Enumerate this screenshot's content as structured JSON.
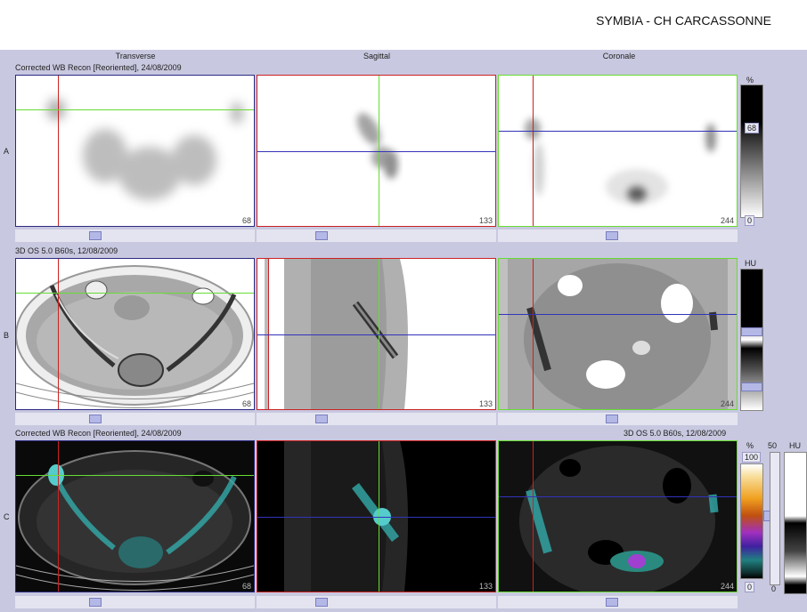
{
  "header": {
    "title": "SYMBIA - CH CARCASSONNE"
  },
  "columns": [
    "Transverse",
    "Sagittal",
    "Coronale"
  ],
  "rows": {
    "A": {
      "label": "A",
      "series": "Corrected WB Recon [Reoriented], 24/08/2009"
    },
    "B": {
      "label": "B",
      "series": "3D  OS  5.0  B60s, 12/08/2009"
    },
    "C": {
      "label": "C",
      "series_left": "Corrected WB Recon [Reoriented], 24/08/2009",
      "series_right": "3D  OS  5.0  B60s, 12/08/2009"
    }
  },
  "slices": {
    "transverse": "68",
    "sagittal": "133",
    "coronal": "244"
  },
  "scale_a": {
    "unit": "%",
    "value": "68",
    "min": "0"
  },
  "scale_b": {
    "unit": "HU"
  },
  "scale_c": {
    "unit_pct": "%",
    "max": "100",
    "min": "0",
    "unit_hu": "HU",
    "mid": "50",
    "min2": "0"
  },
  "colors": {
    "background": "#c8c8e0",
    "crosshair_red": "#cc2222",
    "crosshair_green": "#66dd33",
    "crosshair_blue": "#3333bb"
  }
}
